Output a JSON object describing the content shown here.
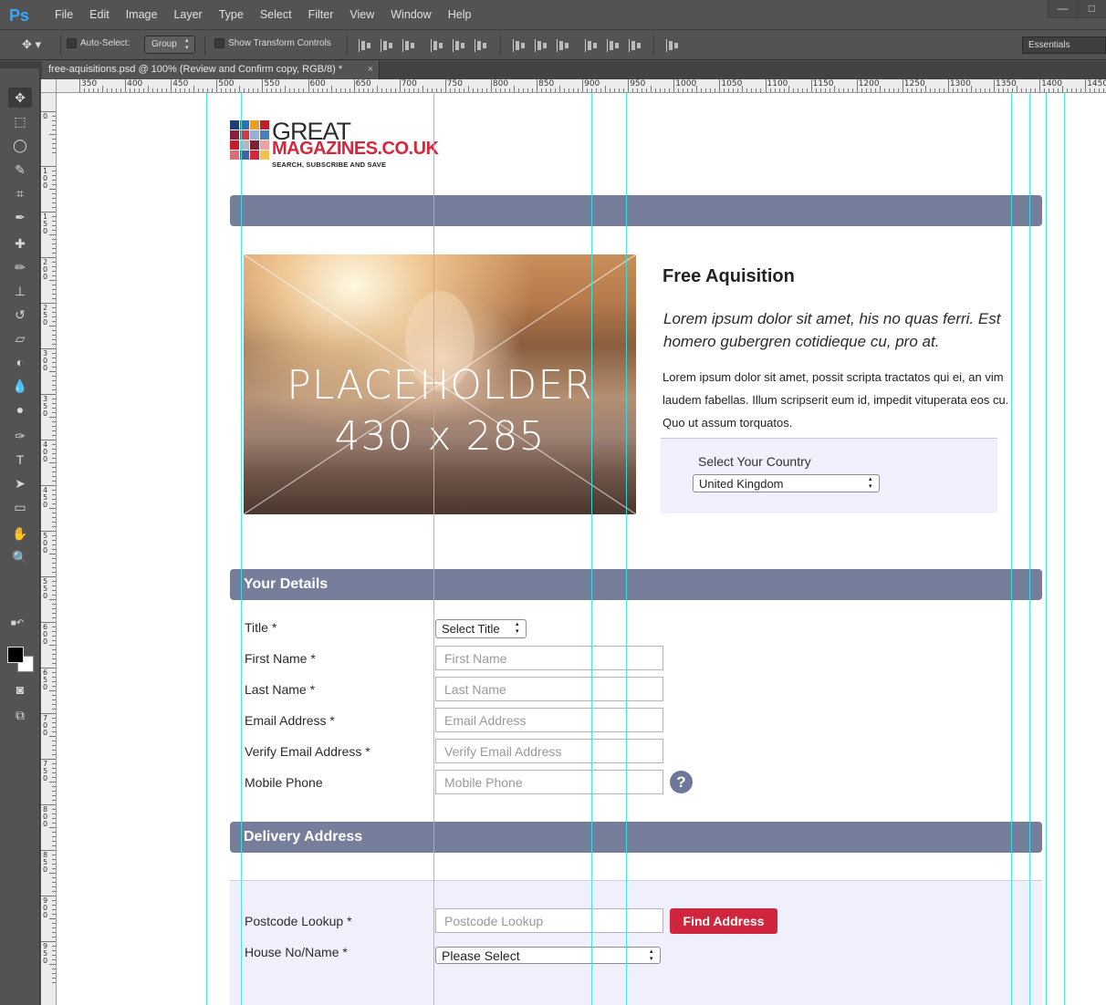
{
  "app": {
    "logo": "Ps",
    "menus": [
      "File",
      "Edit",
      "Image",
      "Layer",
      "Type",
      "Select",
      "Filter",
      "View",
      "Window",
      "Help"
    ],
    "window_controls": {
      "minimize": "—",
      "maximize": "□"
    }
  },
  "options_bar": {
    "auto_select_label": "Auto-Select:",
    "auto_select_value": "Group",
    "show_transform_label": "Show Transform Controls",
    "workspace": "Essentials"
  },
  "document": {
    "tab_title": "free-aquisitions.psd @ 100% (Review and Confirm copy, RGB/8) *",
    "tab_close": "×"
  },
  "tools": [
    {
      "name": "move-tool-icon",
      "glyph": "✥"
    },
    {
      "name": "marquee-tool-icon",
      "glyph": "⬚"
    },
    {
      "name": "lasso-tool-icon",
      "glyph": "◯"
    },
    {
      "name": "quick-select-tool-icon",
      "glyph": "✎"
    },
    {
      "name": "crop-tool-icon",
      "glyph": "⌗"
    },
    {
      "name": "eyedropper-tool-icon",
      "glyph": "✒"
    },
    {
      "name": "healing-brush-tool-icon",
      "glyph": "✚"
    },
    {
      "name": "brush-tool-icon",
      "glyph": "✏"
    },
    {
      "name": "clone-stamp-tool-icon",
      "glyph": "⊥"
    },
    {
      "name": "history-brush-tool-icon",
      "glyph": "↺"
    },
    {
      "name": "eraser-tool-icon",
      "glyph": "▱"
    },
    {
      "name": "paint-bucket-tool-icon",
      "glyph": "◐"
    },
    {
      "name": "blur-tool-icon",
      "glyph": "💧"
    },
    {
      "name": "dodge-tool-icon",
      "glyph": "●"
    },
    {
      "name": "pen-tool-icon",
      "glyph": "✑"
    },
    {
      "name": "type-tool-icon",
      "glyph": "T"
    },
    {
      "name": "path-select-tool-icon",
      "glyph": "➤"
    },
    {
      "name": "shape-tool-icon",
      "glyph": "▭"
    },
    {
      "name": "hand-tool-icon",
      "glyph": "✋"
    },
    {
      "name": "zoom-tool-icon",
      "glyph": "🔍"
    }
  ],
  "ruler": {
    "top_labels": [
      "350",
      "400",
      "450",
      "500",
      "550",
      "600",
      "650",
      "700",
      "750",
      "800",
      "850",
      "900",
      "950",
      "1000",
      "1050",
      "1100",
      "1150",
      "1200",
      "1250",
      "1300",
      "1350",
      "1400",
      "1450"
    ],
    "left_labels": [
      "0",
      "100",
      "150",
      "200",
      "250",
      "300",
      "350",
      "400",
      "450",
      "500",
      "550",
      "600",
      "650",
      "700",
      "750",
      "800",
      "850",
      "900",
      "950"
    ]
  },
  "page": {
    "logo": {
      "great": "GREAT",
      "magazines": "MAGAZINES.CO.UK",
      "tagline": "SEARCH, SUBSCRIBE AND SAVE"
    },
    "placeholder": {
      "line1": "PLACEHOLDER",
      "line2": "430 x 285"
    },
    "promo": {
      "title": "Free Aquisition",
      "lead": "Lorem ipsum dolor sit amet, his no quas ferri. Est homero gubergren cotidieque cu, pro at.",
      "body": "Lorem ipsum dolor sit amet, possit scripta tractatos qui ei, an vim laudem fabellas. Illum scripserit eum id, impedit vituperata eos cu. Quo ut assum torquatos.",
      "country_label": "Select Your Country",
      "country_value": "United Kingdom"
    },
    "your_details": {
      "heading": "Your Details",
      "title_label": "Title *",
      "title_value": "Select Title",
      "fields": [
        {
          "label": "First Name *",
          "placeholder": "First Name"
        },
        {
          "label": "Last Name *",
          "placeholder": "Last Name"
        },
        {
          "label": "Email Address *",
          "placeholder": "Email Address"
        },
        {
          "label": "Verify Email Address *",
          "placeholder": "Verify Email Address"
        },
        {
          "label": "Mobile Phone",
          "placeholder": "Mobile Phone"
        }
      ],
      "help": "?"
    },
    "delivery": {
      "heading": "Delivery Address",
      "postcode_label": "Postcode Lookup *",
      "postcode_placeholder": "Postcode Lookup",
      "find_button": "Find Address",
      "house_label": "House No/Name *",
      "house_value": "Please Select"
    }
  },
  "colors": {
    "section_bar": "#777e9b",
    "brand_red": "#d0263d",
    "panel_bg": "#eff0fb",
    "guide": "#2fe7e7"
  }
}
